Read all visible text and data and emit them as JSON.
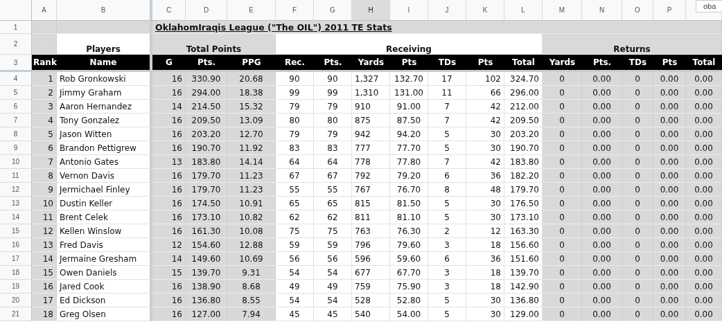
{
  "column_headers": [
    {
      "label": "A",
      "selected": false
    },
    {
      "label": "B",
      "selected": false
    },
    {
      "label": "C",
      "selected": false
    },
    {
      "label": "D",
      "selected": false
    },
    {
      "label": "E",
      "selected": false
    },
    {
      "label": "F",
      "selected": false
    },
    {
      "label": "G",
      "selected": false
    },
    {
      "label": "H",
      "selected": true
    },
    {
      "label": "I",
      "selected": false
    },
    {
      "label": "J",
      "selected": false
    },
    {
      "label": "K",
      "selected": false
    },
    {
      "label": "L",
      "selected": false
    },
    {
      "label": "M",
      "selected": false
    },
    {
      "label": "N",
      "selected": false
    },
    {
      "label": "O",
      "selected": false
    },
    {
      "label": "P",
      "selected": false
    }
  ],
  "popup": {
    "text": "oba"
  },
  "title_row": {
    "row_number": "1",
    "title": "OklahomIraqis League (\"The OIL\") 2011 TE Stats"
  },
  "group_row": {
    "row_number": "2",
    "players": "Players",
    "total_points": "Total Points",
    "receiving": "Receiving",
    "returns": "Returns"
  },
  "heading_row": {
    "row_number": "3",
    "headings": [
      "Rank",
      "Name",
      "G",
      "Pts.",
      "PPG",
      "Rec.",
      "Pts.",
      "Yards",
      "Pts",
      "TDs",
      "Pts",
      "Total",
      "Yards",
      "Pts.",
      "TDs",
      "Pts",
      "Total"
    ]
  },
  "rows": [
    {
      "row_number": "4",
      "cells": [
        "1",
        "Rob Gronkowski",
        "16",
        "330.90",
        "20.68",
        "90",
        "90",
        "1,327",
        "132.70",
        "17",
        "102",
        "324.70",
        "0",
        "0.00",
        "0",
        "0.00",
        "0.00"
      ]
    },
    {
      "row_number": "5",
      "cells": [
        "2",
        "Jimmy Graham",
        "16",
        "294.00",
        "18.38",
        "99",
        "99",
        "1,310",
        "131.00",
        "11",
        "66",
        "296.00",
        "0",
        "0.00",
        "0",
        "0.00",
        "0.00"
      ]
    },
    {
      "row_number": "6",
      "cells": [
        "3",
        "Aaron Hernandez",
        "14",
        "214.50",
        "15.32",
        "79",
        "79",
        "910",
        "91.00",
        "7",
        "42",
        "212.00",
        "0",
        "0.00",
        "0",
        "0.00",
        "0.00"
      ]
    },
    {
      "row_number": "7",
      "cells": [
        "4",
        "Tony Gonzalez",
        "16",
        "209.50",
        "13.09",
        "80",
        "80",
        "875",
        "87.50",
        "7",
        "42",
        "209.50",
        "0",
        "0.00",
        "0",
        "0.00",
        "0.00"
      ]
    },
    {
      "row_number": "8",
      "cells": [
        "5",
        "Jason Witten",
        "16",
        "203.20",
        "12.70",
        "79",
        "79",
        "942",
        "94.20",
        "5",
        "30",
        "203.20",
        "0",
        "0.00",
        "0",
        "0.00",
        "0.00"
      ]
    },
    {
      "row_number": "9",
      "cells": [
        "6",
        "Brandon Pettigrew",
        "16",
        "190.70",
        "11.92",
        "83",
        "83",
        "777",
        "77.70",
        "5",
        "30",
        "190.70",
        "0",
        "0.00",
        "0",
        "0.00",
        "0.00"
      ]
    },
    {
      "row_number": "10",
      "cells": [
        "7",
        "Antonio Gates",
        "13",
        "183.80",
        "14.14",
        "64",
        "64",
        "778",
        "77.80",
        "7",
        "42",
        "183.80",
        "0",
        "0.00",
        "0",
        "0.00",
        "0.00"
      ]
    },
    {
      "row_number": "11",
      "cells": [
        "8",
        "Vernon Davis",
        "16",
        "179.70",
        "11.23",
        "67",
        "67",
        "792",
        "79.20",
        "6",
        "36",
        "182.20",
        "0",
        "0.00",
        "0",
        "0.00",
        "0.00"
      ]
    },
    {
      "row_number": "12",
      "cells": [
        "9",
        "Jermichael Finley",
        "16",
        "179.70",
        "11.23",
        "55",
        "55",
        "767",
        "76.70",
        "8",
        "48",
        "179.70",
        "0",
        "0.00",
        "0",
        "0.00",
        "0.00"
      ]
    },
    {
      "row_number": "13",
      "cells": [
        "10",
        "Dustin Keller",
        "16",
        "174.50",
        "10.91",
        "65",
        "65",
        "815",
        "81.50",
        "5",
        "30",
        "176.50",
        "0",
        "0.00",
        "0",
        "0.00",
        "0.00"
      ]
    },
    {
      "row_number": "14",
      "cells": [
        "11",
        "Brent Celek",
        "16",
        "173.10",
        "10.82",
        "62",
        "62",
        "811",
        "81.10",
        "5",
        "30",
        "173.10",
        "0",
        "0.00",
        "0",
        "0.00",
        "0.00"
      ]
    },
    {
      "row_number": "15",
      "cells": [
        "12",
        "Kellen Winslow",
        "16",
        "161.30",
        "10.08",
        "75",
        "75",
        "763",
        "76.30",
        "2",
        "12",
        "163.30",
        "0",
        "0.00",
        "0",
        "0.00",
        "0.00"
      ]
    },
    {
      "row_number": "16",
      "cells": [
        "13",
        "Fred Davis",
        "12",
        "154.60",
        "12.88",
        "59",
        "59",
        "796",
        "79.60",
        "3",
        "18",
        "156.60",
        "0",
        "0.00",
        "0",
        "0.00",
        "0.00"
      ]
    },
    {
      "row_number": "17",
      "cells": [
        "14",
        "Jermaine Gresham",
        "14",
        "149.60",
        "10.69",
        "56",
        "56",
        "596",
        "59.60",
        "6",
        "36",
        "151.60",
        "0",
        "0.00",
        "0",
        "0.00",
        "0.00"
      ]
    },
    {
      "row_number": "18",
      "cells": [
        "15",
        "Owen Daniels",
        "15",
        "139.70",
        "9.31",
        "54",
        "54",
        "677",
        "67.70",
        "3",
        "18",
        "139.70",
        "0",
        "0.00",
        "0",
        "0.00",
        "0.00"
      ]
    },
    {
      "row_number": "19",
      "cells": [
        "16",
        "Jared Cook",
        "16",
        "138.90",
        "8.68",
        "49",
        "49",
        "759",
        "75.90",
        "3",
        "18",
        "142.90",
        "0",
        "0.00",
        "0",
        "0.00",
        "0.00"
      ]
    },
    {
      "row_number": "20",
      "cells": [
        "17",
        "Ed Dickson",
        "16",
        "136.80",
        "8.55",
        "54",
        "54",
        "528",
        "52.80",
        "5",
        "30",
        "136.80",
        "0",
        "0.00",
        "0",
        "0.00",
        "0.00"
      ]
    },
    {
      "row_number": "21",
      "cells": [
        "18",
        "Greg Olsen",
        "16",
        "127.00",
        "7.94",
        "45",
        "45",
        "540",
        "54.00",
        "5",
        "30",
        "129.00",
        "0",
        "0.00",
        "0",
        "0.00",
        "0.00"
      ]
    }
  ]
}
